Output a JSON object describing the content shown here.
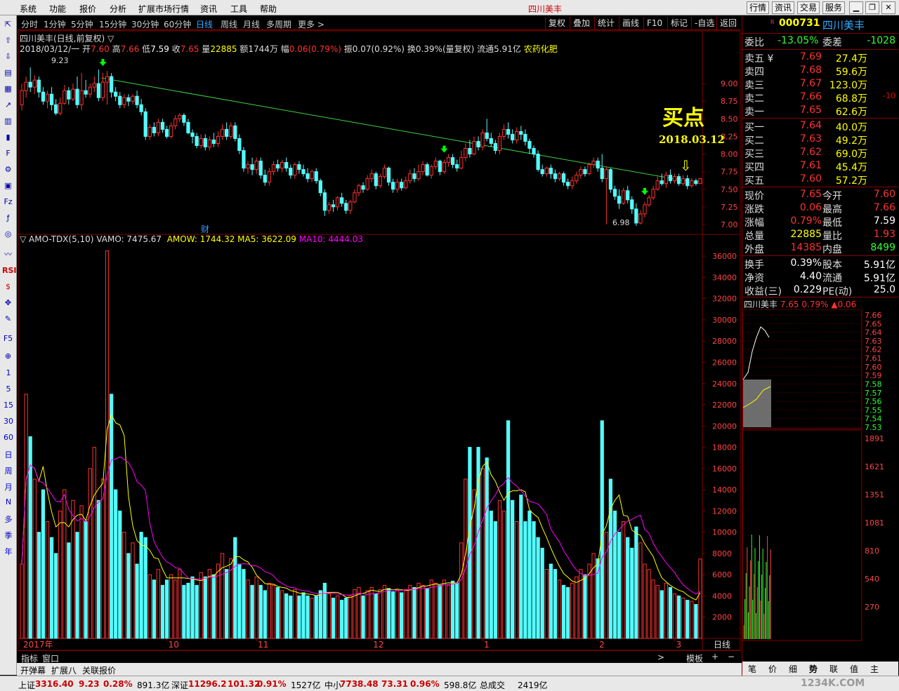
{
  "menu": [
    "系统",
    "功能",
    "报价",
    "分析",
    "扩展市场行情",
    "资讯",
    "工具",
    "帮助"
  ],
  "window_title": "四川美丰",
  "top_buttons": [
    "行情",
    "资讯",
    "交易",
    "服务"
  ],
  "left_toolbar_labels": [
    "1",
    "5",
    "15",
    "30",
    "60",
    "日",
    "周",
    "月",
    "N",
    "多",
    "季",
    "年"
  ],
  "periods": [
    "分时",
    "1分钟",
    "5分钟",
    "15分钟",
    "30分钟",
    "60分钟",
    "日线",
    "周线",
    "月线",
    "多周期",
    "更多 >"
  ],
  "selected_period": "日线",
  "tools": [
    "复权",
    "叠加",
    "统计",
    "画线",
    "F10",
    "标记",
    "-自选",
    "返回"
  ],
  "info_line": {
    "name": "四川美丰(日线,前复权) ▽",
    "date": "2018/03/12/一",
    "open_label": "开",
    "open": "7.60",
    "high_label": "高",
    "high": "7.66",
    "low_label": "低",
    "low": "7.59",
    "close_label": "收",
    "close": "7.65",
    "vol_label": "量",
    "vol": "22885",
    "amt_label": "额",
    "amt": "1744万",
    "range_label": "幅",
    "range": "0.06(0.79%)",
    "amp_label": "振",
    "amp": "0.07(0.92%)",
    "turnover_label": "换",
    "turnover": "0.39%(量复权)",
    "float_label": "流通",
    "float": "5.91亿",
    "sector": "农药化肥"
  },
  "annotations": {
    "buy_point": "买点",
    "buy_date": "2018.03.12",
    "high_mark": "9.23",
    "low_mark": "6.98",
    "cai": "财"
  },
  "indicator_line": {
    "name": "▽ AMO-TDX(5,10)",
    "vamo": "VAMO: 7475.67",
    "amow": "AMOW: 1744.32",
    "ma5": "MA5: 3622.09",
    "ma10": "MA10: 4444.03"
  },
  "colors": {
    "up": "#ff3232",
    "down": "#54fcfc",
    "trend": "#40d040",
    "ma5": "#ffff00",
    "ma10": "#ff00ff",
    "arrow": "#00ff00",
    "grid": "#800000"
  },
  "chart_data": {
    "type": "candlestick",
    "price_axis": {
      "ticks": [
        "9.00",
        "8.75",
        "8.50",
        "8.25",
        "8.00",
        "7.75",
        "7.50",
        "7.25",
        "7.00"
      ],
      "min": 6.9,
      "max": 9.35
    },
    "volume_axis": {
      "ticks": [
        "36000",
        "34000",
        "32000",
        "30000",
        "28000",
        "26000",
        "24000",
        "22000",
        "20000",
        "18000",
        "16000",
        "14000",
        "12000",
        "10000",
        "8000",
        "6000",
        "4000",
        "2000"
      ],
      "min": 0,
      "max": 37000
    },
    "x_labels": [
      "2017年",
      "10",
      "11",
      "12",
      "1",
      "2",
      "3"
    ],
    "x_label_positions": [
      0,
      38,
      62,
      92,
      122,
      152,
      172
    ],
    "period_label": "日线",
    "trend_line": [
      [
        21,
        9.08
      ],
      [
        176,
        7.61
      ]
    ],
    "buy_arrows": [
      21,
      111,
      164
    ],
    "candles": [
      [
        8.7,
        8.9,
        9.0,
        8.62,
        7000
      ],
      [
        8.9,
        9.02,
        9.1,
        8.8,
        23000
      ],
      [
        9.02,
        8.95,
        9.23,
        8.88,
        19000
      ],
      [
        8.95,
        9.05,
        9.12,
        8.85,
        15000
      ],
      [
        9.05,
        8.88,
        9.1,
        8.8,
        10000
      ],
      [
        8.88,
        8.75,
        8.95,
        8.7,
        14000
      ],
      [
        8.75,
        8.85,
        8.9,
        8.65,
        11000
      ],
      [
        8.85,
        8.7,
        8.95,
        8.62,
        9500
      ],
      [
        8.7,
        8.58,
        8.78,
        8.55,
        8000
      ],
      [
        8.58,
        8.72,
        8.8,
        8.55,
        12000
      ],
      [
        8.72,
        8.9,
        8.98,
        8.7,
        14000
      ],
      [
        8.9,
        8.78,
        8.95,
        8.7,
        9000
      ],
      [
        8.78,
        8.92,
        9.0,
        8.75,
        13000
      ],
      [
        8.92,
        8.7,
        9.1,
        8.65,
        10000
      ],
      [
        8.7,
        8.9,
        9.15,
        8.62,
        12500
      ],
      [
        8.9,
        8.85,
        9.05,
        8.8,
        11000
      ],
      [
        8.85,
        8.95,
        9.0,
        8.8,
        16000
      ],
      [
        8.95,
        9.0,
        9.1,
        8.88,
        18000
      ],
      [
        9.0,
        8.8,
        9.2,
        8.75,
        13000
      ],
      [
        8.8,
        9.02,
        9.15,
        8.75,
        15000
      ],
      [
        9.02,
        9.1,
        9.18,
        8.7,
        36500
      ],
      [
        9.1,
        8.88,
        9.15,
        8.8,
        23000
      ],
      [
        8.88,
        8.82,
        8.95,
        8.75,
        14000
      ],
      [
        8.82,
        8.7,
        8.88,
        8.65,
        12000
      ],
      [
        8.7,
        8.8,
        8.85,
        8.65,
        10000
      ],
      [
        8.8,
        8.75,
        8.85,
        8.68,
        8000
      ],
      [
        8.75,
        8.82,
        8.85,
        8.7,
        9000
      ],
      [
        8.82,
        8.7,
        8.9,
        8.65,
        7000
      ],
      [
        8.7,
        8.6,
        8.78,
        8.55,
        10000
      ],
      [
        8.6,
        8.25,
        8.65,
        8.2,
        9500
      ],
      [
        8.25,
        8.38,
        8.42,
        8.2,
        6000
      ],
      [
        8.38,
        8.3,
        8.45,
        8.25,
        5500
      ],
      [
        8.3,
        8.45,
        8.5,
        8.25,
        6500
      ],
      [
        8.45,
        8.35,
        8.5,
        8.3,
        5000
      ],
      [
        8.35,
        8.25,
        8.4,
        8.22,
        5500
      ],
      [
        8.25,
        8.4,
        8.45,
        8.22,
        6000
      ],
      [
        8.4,
        8.5,
        8.55,
        8.35,
        5500
      ],
      [
        8.5,
        8.55,
        8.58,
        8.45,
        6500
      ],
      [
        8.55,
        8.45,
        8.58,
        8.4,
        5000
      ],
      [
        8.45,
        8.3,
        8.5,
        8.28,
        5200
      ],
      [
        8.3,
        8.25,
        8.35,
        8.15,
        5800
      ],
      [
        8.25,
        8.12,
        8.3,
        8.08,
        5000
      ],
      [
        8.12,
        8.22,
        8.28,
        8.08,
        6200
      ],
      [
        8.22,
        8.1,
        8.28,
        8.05,
        5800
      ],
      [
        8.1,
        8.2,
        8.25,
        8.05,
        6500
      ],
      [
        8.2,
        8.15,
        8.3,
        8.1,
        6000
      ],
      [
        8.15,
        8.25,
        8.32,
        8.1,
        7000
      ],
      [
        8.25,
        8.35,
        8.42,
        8.2,
        8000
      ],
      [
        8.35,
        8.25,
        8.45,
        8.2,
        6500
      ],
      [
        8.25,
        8.4,
        8.45,
        8.22,
        7500
      ],
      [
        8.4,
        8.22,
        8.45,
        8.18,
        9500
      ],
      [
        8.22,
        8.05,
        8.28,
        8.0,
        7000
      ],
      [
        8.05,
        7.8,
        8.1,
        7.75,
        6500
      ],
      [
        7.8,
        7.85,
        7.9,
        7.72,
        5500
      ],
      [
        7.85,
        7.78,
        7.95,
        7.7,
        5000
      ],
      [
        7.78,
        7.9,
        7.95,
        7.72,
        5800
      ],
      [
        7.9,
        7.7,
        7.95,
        7.65,
        5000
      ],
      [
        7.7,
        7.6,
        7.78,
        7.55,
        4500
      ],
      [
        7.6,
        7.75,
        7.8,
        7.55,
        5200
      ],
      [
        7.75,
        7.85,
        7.9,
        7.7,
        5000
      ],
      [
        7.85,
        7.8,
        7.92,
        7.75,
        4800
      ],
      [
        7.8,
        7.88,
        7.92,
        7.74,
        4500
      ],
      [
        7.88,
        7.8,
        7.95,
        7.75,
        4200
      ],
      [
        7.8,
        7.7,
        7.85,
        7.65,
        4000
      ],
      [
        7.7,
        7.85,
        7.88,
        7.65,
        4600
      ],
      [
        7.85,
        7.78,
        7.9,
        7.72,
        4000
      ],
      [
        7.78,
        7.72,
        7.85,
        7.68,
        4300
      ],
      [
        7.72,
        7.65,
        7.8,
        7.6,
        4000
      ],
      [
        7.65,
        7.75,
        7.78,
        7.6,
        3800
      ],
      [
        7.75,
        7.62,
        7.8,
        7.58,
        4000
      ],
      [
        7.62,
        7.45,
        7.65,
        7.4,
        4500
      ],
      [
        7.45,
        7.2,
        7.5,
        7.12,
        5200
      ],
      [
        7.2,
        7.28,
        7.32,
        7.15,
        4200
      ],
      [
        7.28,
        7.25,
        7.35,
        7.18,
        3800
      ],
      [
        7.25,
        7.38,
        7.4,
        7.2,
        4000
      ],
      [
        7.38,
        7.3,
        7.45,
        7.25,
        3600
      ],
      [
        7.3,
        7.2,
        7.35,
        7.15,
        3800
      ],
      [
        7.2,
        7.32,
        7.35,
        7.15,
        4000
      ],
      [
        7.32,
        7.45,
        7.5,
        7.3,
        4600
      ],
      [
        7.45,
        7.55,
        7.58,
        7.4,
        4800
      ],
      [
        7.55,
        7.5,
        7.6,
        7.45,
        4000
      ],
      [
        7.5,
        7.65,
        7.7,
        7.48,
        4500
      ],
      [
        7.65,
        7.72,
        7.78,
        7.6,
        4800
      ],
      [
        7.72,
        7.55,
        7.75,
        7.5,
        4200
      ],
      [
        7.55,
        7.68,
        7.72,
        7.52,
        4600
      ],
      [
        7.68,
        7.8,
        7.85,
        7.65,
        5000
      ],
      [
        7.8,
        7.6,
        7.82,
        7.55,
        4700
      ],
      [
        7.6,
        7.5,
        7.65,
        7.45,
        4400
      ],
      [
        7.5,
        7.6,
        7.65,
        7.45,
        4500
      ],
      [
        7.6,
        7.52,
        7.65,
        7.48,
        4300
      ],
      [
        7.52,
        7.62,
        7.68,
        7.5,
        4600
      ],
      [
        7.62,
        7.72,
        7.78,
        7.58,
        5000
      ],
      [
        7.72,
        7.65,
        7.8,
        7.6,
        4800
      ],
      [
        7.65,
        7.75,
        7.85,
        7.62,
        5200
      ],
      [
        7.75,
        7.85,
        7.9,
        7.7,
        5000
      ],
      [
        7.85,
        7.7,
        7.88,
        7.68,
        4700
      ],
      [
        7.7,
        7.82,
        7.85,
        7.65,
        5500
      ],
      [
        7.82,
        7.9,
        7.95,
        7.78,
        5200
      ],
      [
        7.9,
        7.75,
        7.92,
        7.7,
        5000
      ],
      [
        7.75,
        7.88,
        7.92,
        7.72,
        5500
      ],
      [
        7.88,
        7.95,
        8.0,
        7.82,
        5000
      ],
      [
        7.95,
        7.85,
        8.0,
        7.8,
        5400
      ],
      [
        7.85,
        7.8,
        7.92,
        7.75,
        5200
      ],
      [
        7.8,
        7.95,
        8.05,
        7.78,
        9000
      ],
      [
        7.95,
        8.08,
        8.15,
        7.9,
        15000
      ],
      [
        8.08,
        8.0,
        8.2,
        7.95,
        18000
      ],
      [
        8.0,
        8.18,
        8.25,
        7.98,
        14000
      ],
      [
        8.18,
        8.1,
        8.25,
        8.05,
        18000
      ],
      [
        8.1,
        8.3,
        8.35,
        8.05,
        16000
      ],
      [
        8.3,
        8.22,
        8.5,
        8.18,
        17000
      ],
      [
        8.22,
        8.15,
        8.3,
        8.1,
        12000
      ],
      [
        8.15,
        8.05,
        8.2,
        8.0,
        11000
      ],
      [
        8.05,
        8.25,
        8.3,
        8.0,
        13000
      ],
      [
        8.25,
        8.35,
        8.42,
        8.2,
        12000
      ],
      [
        8.35,
        8.28,
        8.45,
        8.22,
        20500
      ],
      [
        8.28,
        8.2,
        8.35,
        8.15,
        13000
      ],
      [
        8.2,
        8.32,
        8.38,
        8.15,
        11000
      ],
      [
        8.32,
        8.28,
        8.4,
        8.2,
        13500
      ],
      [
        8.28,
        8.18,
        8.35,
        8.12,
        11000
      ],
      [
        8.18,
        8.08,
        8.22,
        8.0,
        12000
      ],
      [
        8.08,
        8.0,
        8.12,
        7.95,
        11000
      ],
      [
        8.0,
        7.78,
        8.05,
        7.75,
        9500
      ],
      [
        7.78,
        7.72,
        7.85,
        7.68,
        8500
      ],
      [
        7.72,
        7.8,
        7.82,
        7.68,
        6500
      ],
      [
        7.8,
        7.72,
        7.85,
        7.65,
        7000
      ],
      [
        7.72,
        7.65,
        7.78,
        7.6,
        6500
      ],
      [
        7.65,
        7.72,
        7.75,
        7.62,
        5500
      ],
      [
        7.72,
        7.6,
        7.75,
        7.55,
        5000
      ],
      [
        7.6,
        7.55,
        7.65,
        7.5,
        4800
      ],
      [
        7.55,
        7.62,
        7.68,
        7.5,
        5200
      ],
      [
        7.62,
        7.7,
        7.75,
        7.58,
        5800
      ],
      [
        7.7,
        7.78,
        7.82,
        7.65,
        6500
      ],
      [
        7.78,
        7.72,
        7.82,
        7.68,
        6000
      ],
      [
        7.72,
        7.85,
        7.88,
        7.7,
        7000
      ],
      [
        7.85,
        7.9,
        7.95,
        7.8,
        8000
      ],
      [
        7.9,
        7.8,
        7.95,
        7.75,
        7500
      ],
      [
        7.8,
        7.65,
        8.0,
        7.6,
        20500
      ],
      [
        7.65,
        7.78,
        7.82,
        7.0,
        10000
      ],
      [
        7.78,
        7.5,
        7.8,
        7.45,
        15000
      ],
      [
        7.5,
        7.4,
        7.55,
        7.35,
        12000
      ],
      [
        7.4,
        7.3,
        7.5,
        7.22,
        10000
      ],
      [
        7.3,
        7.48,
        7.52,
        7.28,
        11000
      ],
      [
        7.48,
        7.35,
        7.55,
        7.3,
        9500
      ],
      [
        7.35,
        7.22,
        7.4,
        7.15,
        8500
      ],
      [
        7.22,
        7.02,
        7.3,
        6.98,
        10500
      ],
      [
        7.02,
        7.15,
        7.2,
        7.0,
        9000
      ],
      [
        7.15,
        7.28,
        7.32,
        7.1,
        7000
      ],
      [
        7.28,
        7.38,
        7.42,
        7.25,
        6500
      ],
      [
        7.38,
        7.5,
        7.55,
        7.35,
        5500
      ],
      [
        7.5,
        7.62,
        7.68,
        7.48,
        5000
      ],
      [
        7.62,
        7.58,
        7.72,
        7.55,
        4500
      ],
      [
        7.58,
        7.7,
        7.75,
        7.52,
        5200
      ],
      [
        7.7,
        7.62,
        7.78,
        7.58,
        4800
      ],
      [
        7.62,
        7.68,
        7.72,
        7.58,
        4200
      ],
      [
        7.68,
        7.58,
        7.72,
        7.55,
        4000
      ],
      [
        7.58,
        7.65,
        7.7,
        7.55,
        3800
      ],
      [
        7.65,
        7.55,
        7.7,
        7.5,
        3600
      ],
      [
        7.55,
        7.62,
        7.66,
        7.52,
        3500
      ],
      [
        7.62,
        7.58,
        7.65,
        7.55,
        3200
      ],
      [
        7.58,
        7.65,
        7.66,
        7.59,
        7475
      ]
    ]
  },
  "quote": {
    "code": "000731",
    "code_prefix": "R",
    "name": "四川美丰",
    "webi_label": "委比",
    "webi": "-13.05%",
    "weicha_label": "委差",
    "weicha": "-1028",
    "asks": [
      {
        "label": "卖五 ¥",
        "price": "7.69",
        "vol": "27.4万",
        "chg": ""
      },
      {
        "label": "卖四",
        "price": "7.68",
        "vol": "59.6万",
        "chg": ""
      },
      {
        "label": "卖三",
        "price": "7.67",
        "vol": "123.0万",
        "chg": ""
      },
      {
        "label": "卖二",
        "price": "7.66",
        "vol": "68.8万",
        "chg": "-10"
      },
      {
        "label": "卖一",
        "price": "7.65",
        "vol": "62.6万",
        "chg": ""
      }
    ],
    "bids": [
      {
        "label": "买一",
        "price": "7.64",
        "vol": "40.0万"
      },
      {
        "label": "买二",
        "price": "7.63",
        "vol": "49.2万"
      },
      {
        "label": "买三",
        "price": "7.62",
        "vol": "69.0万"
      },
      {
        "label": "买四",
        "price": "7.61",
        "vol": "45.4万"
      },
      {
        "label": "买五",
        "price": "7.60",
        "vol": "57.2万"
      }
    ],
    "stats": [
      {
        "l1": "现价",
        "v1": "7.65",
        "c1": "red",
        "l2": "今开",
        "v2": "7.60",
        "c2": "red"
      },
      {
        "l1": "涨跌",
        "v1": "0.06",
        "c1": "red",
        "l2": "最高",
        "v2": "7.66",
        "c2": "red"
      },
      {
        "l1": "涨幅",
        "v1": "0.79%",
        "c1": "red",
        "l2": "最低",
        "v2": "7.59",
        "c2": "wht"
      },
      {
        "l1": "总量",
        "v1": "22885",
        "c1": "yel",
        "l2": "量比",
        "v2": "1.93",
        "c2": "red"
      },
      {
        "l1": "外盘",
        "v1": "14385",
        "c1": "red",
        "l2": "内盘",
        "v2": "8499",
        "c2": "grn"
      }
    ],
    "fund": [
      {
        "l1": "换手",
        "v1": "0.39%",
        "l2": "股本",
        "v2": "5.91亿"
      },
      {
        "l1": "净资",
        "v1": "4.40",
        "l2": "流通",
        "v2": "5.91亿"
      },
      {
        "l1": "收益(三)",
        "v1": "0.229",
        "l2": "PE(动)",
        "v2": "25.0"
      }
    ],
    "mini_title": "四川美丰",
    "mini_price": "7.65",
    "mini_pct": "0.79%",
    "mini_chg": "▲0.06",
    "mini_price_ticks": [
      "7.66",
      "7.65",
      "7.64",
      "7.63",
      "7.62",
      "7.61",
      "7.60",
      "7.59",
      "7.58",
      "7.57",
      "7.56",
      "7.55",
      "7.54",
      "7.53"
    ],
    "mini_vol_ticks": [
      "1891",
      "1621",
      "1351",
      "1081",
      "810",
      "540",
      "270"
    ],
    "bottom_tabs": [
      "笔",
      "价",
      "细",
      "势",
      "联",
      "值",
      "主"
    ],
    "selected_tab": "势"
  },
  "bottom": {
    "tabs1": [
      "指标",
      "窗口"
    ],
    "tabs2": [
      "开弹幕",
      "扩展八",
      "关联报价"
    ],
    "template": "模板",
    "period_label": "日线"
  },
  "status": {
    "sh_label": "上证",
    "sh": "3316.40",
    "sh_chg": "9.23",
    "sh_pct": "0.28%",
    "sh_amt": "891.3亿",
    "sz_label": "深证",
    "sz": "11296.2",
    "sz_chg": "101.32",
    "sz_pct": "0.91%",
    "sz_amt": "1527亿",
    "zx_label": "中小",
    "zx": "7738.48",
    "zx_chg": "73.31",
    "zx_pct": "0.96%",
    "zx_amt": "598.8亿",
    "total_label": "总成交",
    "total": "2419亿",
    "watermark": "1234K.COM"
  }
}
